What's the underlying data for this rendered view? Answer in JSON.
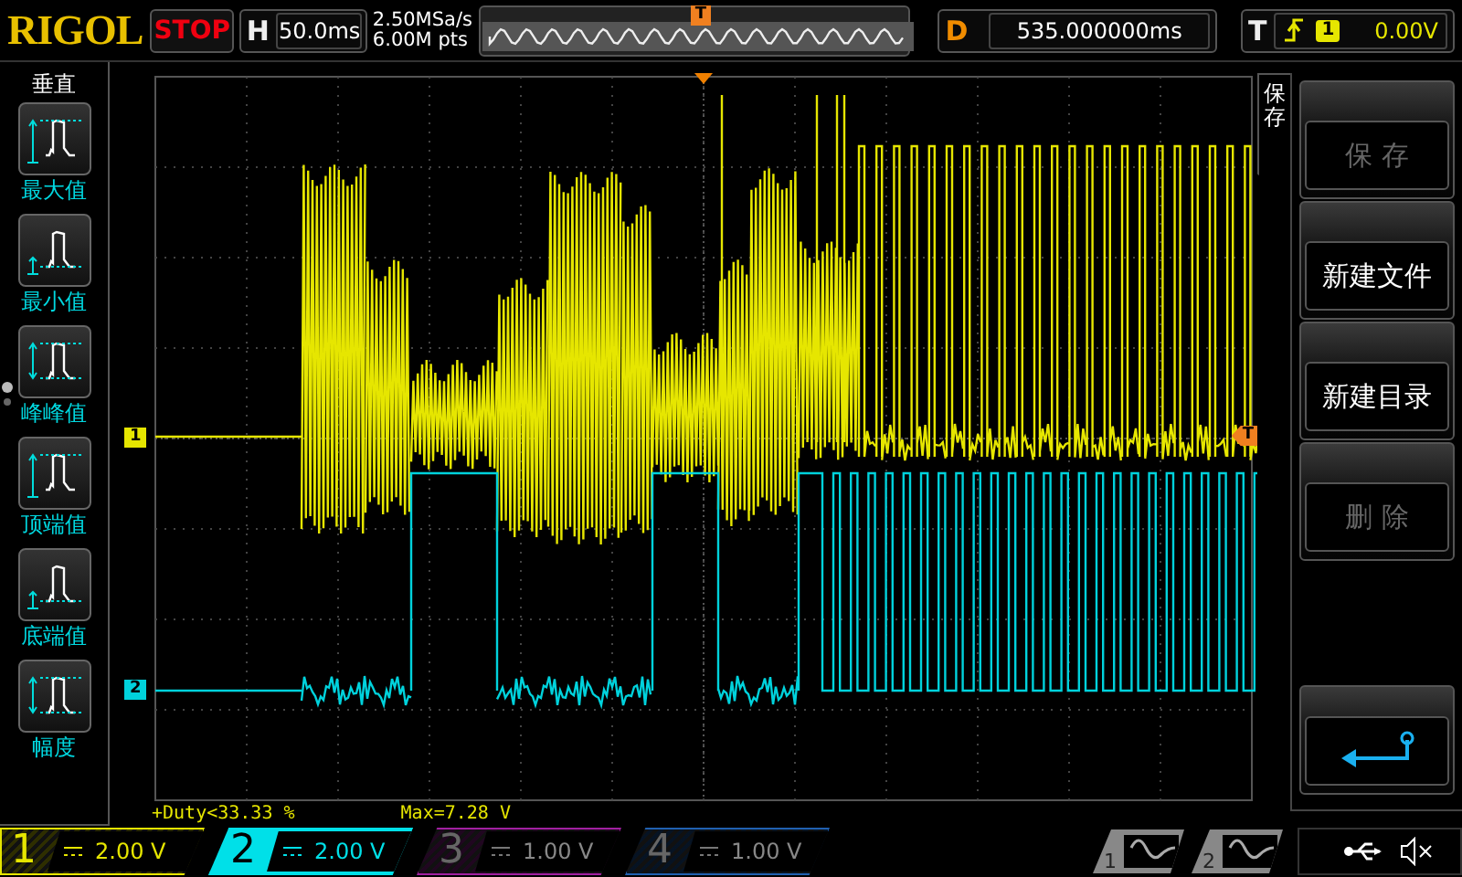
{
  "header": {
    "logo": "RIGOL",
    "run_state": "STOP",
    "horizontal": {
      "label": "H",
      "value": "50.0ms"
    },
    "sample_rate": "2.50MSa/s",
    "memory_depth": "6.00M pts",
    "memory_marker": "T",
    "delay": {
      "label": "D",
      "value": "535.000000ms"
    },
    "trigger": {
      "label": "T",
      "source": "1",
      "level": "0.00V"
    }
  },
  "left_menu": {
    "title": "垂直",
    "items": [
      {
        "kind": "max",
        "label": "最大值"
      },
      {
        "kind": "min",
        "label": "最小值"
      },
      {
        "kind": "peak",
        "label": "峰峰值"
      },
      {
        "kind": "top",
        "label": "顶端值"
      },
      {
        "kind": "base",
        "label": "底端值"
      },
      {
        "kind": "amplitude",
        "label": "幅度"
      }
    ]
  },
  "scope": {
    "channel_markers": [
      {
        "label": "1",
        "color": "#e6e600"
      },
      {
        "label": "2",
        "color": "#00d2dc"
      }
    ],
    "trigger_level_marker": "T",
    "measurements": [
      "+Duty<33.33 %",
      "Max=7.28 V"
    ]
  },
  "right_menu": {
    "tab": "保存",
    "buttons": [
      {
        "kind": "text",
        "label": "保 存",
        "disabled": true
      },
      {
        "kind": "text",
        "label": "新建文件",
        "disabled": false
      },
      {
        "kind": "text",
        "label": "新建目录",
        "disabled": false
      },
      {
        "kind": "text",
        "label": "删 除",
        "disabled": true
      },
      {
        "kind": "back"
      }
    ]
  },
  "channels": [
    {
      "number": "1",
      "scale": "2.00 V",
      "on": true,
      "selected": false,
      "color": "#e6e600"
    },
    {
      "number": "2",
      "scale": "2.00 V",
      "on": true,
      "selected": true,
      "color": "#00e0e8"
    },
    {
      "number": "3",
      "scale": "1.00 V",
      "on": false,
      "selected": false,
      "color": "#a020a0"
    },
    {
      "number": "4",
      "scale": "1.00 V",
      "on": false,
      "selected": false,
      "color": "#2060b0"
    }
  ],
  "generators": [
    {
      "number": "1"
    },
    {
      "number": "2"
    }
  ]
}
